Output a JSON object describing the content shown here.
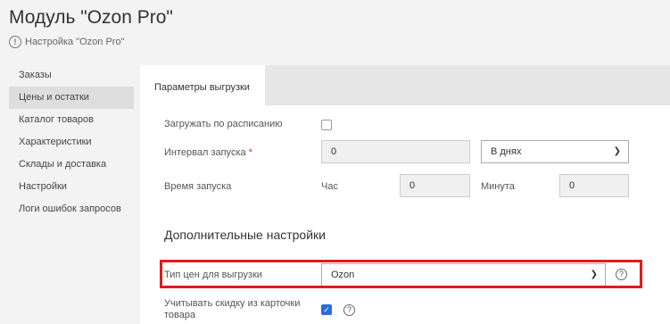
{
  "page": {
    "title": "Модуль \"Ozon Pro\""
  },
  "breadcrumb": {
    "icon": "info-circle-icon",
    "text": "Настройка \"Ozon Pro\""
  },
  "sidebar": {
    "items": [
      {
        "label": "Заказы",
        "active": false
      },
      {
        "label": "Цены и остатки",
        "active": true
      },
      {
        "label": "Каталог товаров",
        "active": false
      },
      {
        "label": "Характеристики",
        "active": false
      },
      {
        "label": "Склады и доставка",
        "active": false
      },
      {
        "label": "Настройки",
        "active": false
      },
      {
        "label": "Логи ошибок запросов",
        "active": false
      }
    ]
  },
  "tabs": {
    "active_label": "Параметры выгрузки"
  },
  "form": {
    "schedule_label": "Загружать по расписанию",
    "schedule_checked": false,
    "interval_label": "Интервал запуска",
    "interval_required_mark": "*",
    "interval_value": "0",
    "interval_unit": "В днях",
    "time_label": "Время запуска",
    "hour_label": "Час",
    "hour_value": "0",
    "minute_label": "Минута",
    "minute_value": "0"
  },
  "additional": {
    "title": "Дополнительные настройки",
    "price_type_label": "Тип цен для выгрузки",
    "price_type_value": "Ozon",
    "discount_label_line1": "Учитывать скидку из карточки",
    "discount_label_line2": "товара",
    "discount_checked": true
  },
  "colors": {
    "highlight": "#e01b1b",
    "checkbox_checked": "#2b6fd6"
  }
}
